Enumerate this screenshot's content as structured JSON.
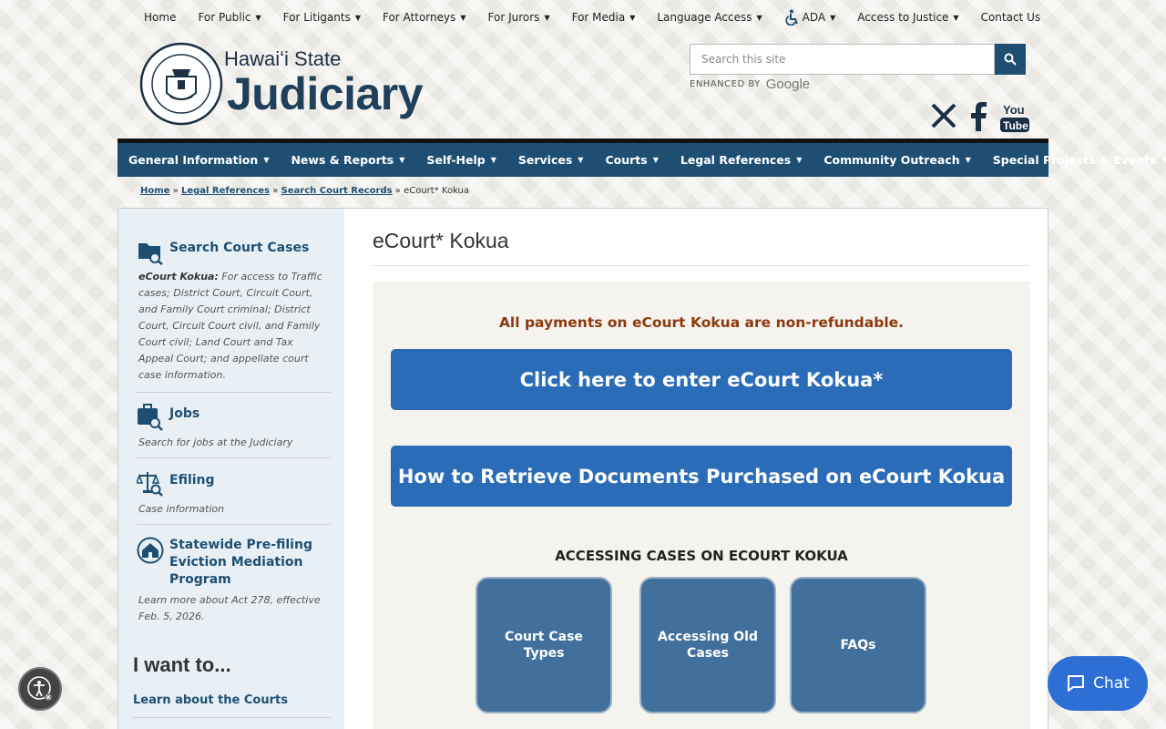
{
  "topnav": {
    "home": "Home",
    "for_public": "For Public",
    "for_litigants": "For Litigants",
    "for_attorneys": "For Attorneys",
    "for_jurors": "For Jurors",
    "for_media": "For Media",
    "language_access": "Language Access",
    "ada": "ADA",
    "access_to_justice": "Access to Justice",
    "contact_us": "Contact Us"
  },
  "brand": {
    "sub": "Hawaiʻi State",
    "main": "Judiciary"
  },
  "search": {
    "placeholder": "Search this site",
    "enhanced_by": "ENHANCED BY",
    "google": "Google"
  },
  "social": {
    "youtube_line1": "You",
    "youtube_line2": "Tube"
  },
  "mainnav": {
    "general_information": "General Information",
    "news_reports": "News & Reports",
    "self_help": "Self-Help",
    "services": "Services",
    "courts": "Courts",
    "legal_references": "Legal References",
    "community_outreach": "Community Outreach",
    "special_projects": "Special Projects & Events"
  },
  "breadcrumb": {
    "home": "Home",
    "legal_references": "Legal References",
    "search_court_records": "Search Court Records",
    "current": "eCourt* Kokua",
    "sep": "»"
  },
  "sidebar": {
    "search_cases": {
      "title": "Search Court Cases",
      "desc_bold": "eCourt Kokua:",
      "desc": " For access to Traffic cases; District Court, Circuit Court, and Family Court criminal; District Court, Circuit Court civil, and Family Court civil; Land Court and Tax Appeal Court; and appellate court case information."
    },
    "jobs": {
      "title": "Jobs",
      "desc": "Search for jobs at the Judiciary"
    },
    "efiling": {
      "title": "Efiling",
      "desc": "Case information"
    },
    "eviction": {
      "title": "Statewide Pre-filing Eviction Mediation Program",
      "desc": "Learn more about Act 278, effective Feb. 5, 2026."
    },
    "iwant": "I want to...",
    "learn_courts": "Learn about the Courts"
  },
  "main": {
    "title": "eCourt* Kokua",
    "notice": "All payments on eCourt Kokua are non-refundable.",
    "enter_button": "Click here to enter eCourt Kokua*",
    "retrieve_button": "How to Retrieve Documents Purchased on eCourt Kokua",
    "section_heading": "ACCESSING CASES ON ECOURT KOKUA",
    "tiles": [
      "Court Case Types",
      "Accessing Old Cases",
      "FAQs"
    ]
  },
  "chat": {
    "label": "Chat"
  },
  "colors": {
    "nav_blue": "#1e4f73",
    "button_blue": "#2b6cb8",
    "tile_blue": "#41709c",
    "notice_brown": "#8b3a0e",
    "chat_blue": "#2e6fd6"
  }
}
